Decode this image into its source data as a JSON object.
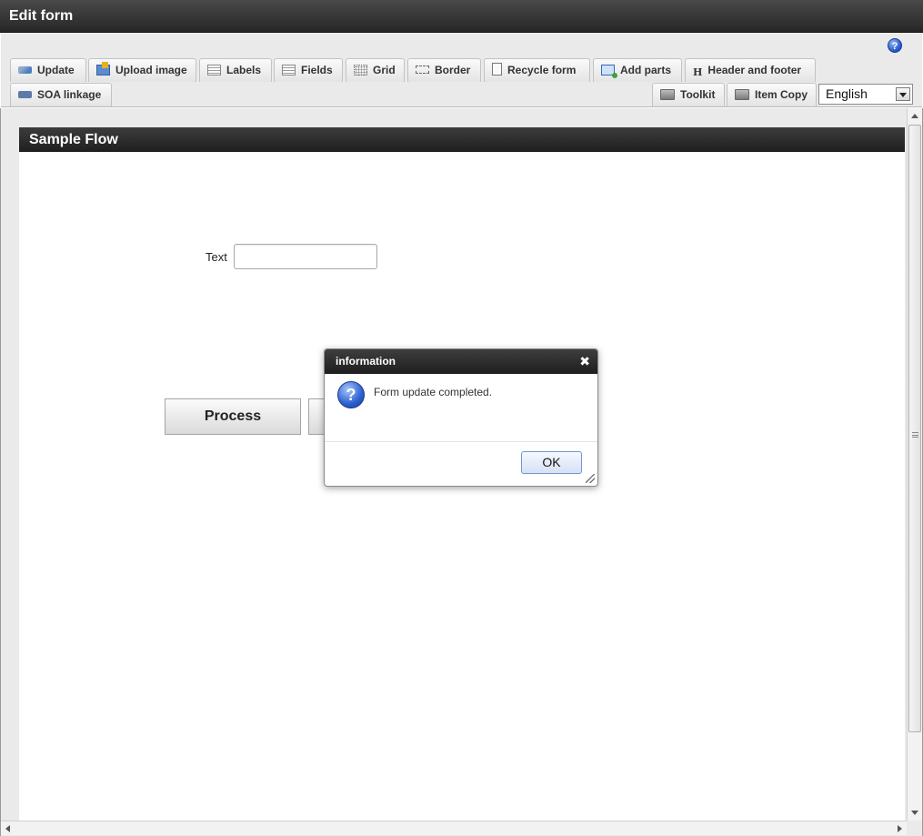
{
  "window": {
    "title": "Edit form"
  },
  "toolbar": {
    "update": "Update",
    "upload_image": "Upload image",
    "labels": "Labels",
    "fields": "Fields",
    "grid": "Grid",
    "border": "Border",
    "recycle_form": "Recycle form",
    "add_parts": "Add parts",
    "header_footer": "Header and footer",
    "header_footer_glyph": "H",
    "soa_linkage": "SOA linkage",
    "toolkit": "Toolkit",
    "item_copy": "Item Copy",
    "language": "English"
  },
  "form": {
    "title": "Sample Flow",
    "text_label": "Text",
    "text_value": "",
    "process_button": "Process",
    "second_button": ""
  },
  "dialog": {
    "title": "information",
    "close": "✖",
    "icon_glyph": "?",
    "message": "Form update completed.",
    "ok": "OK"
  },
  "help": {
    "glyph": "?"
  },
  "icons": {
    "help": "help-icon",
    "update": "update-icon",
    "upload_image": "image-icon",
    "labels": "labels-icon",
    "fields": "fields-icon",
    "grid": "grid-icon",
    "border": "border-icon",
    "recycle": "page-icon",
    "add_parts": "add-parts-icon",
    "header_footer": "header-footer-icon",
    "soa": "share-icon",
    "toolkit": "toolbox-icon",
    "item_copy": "toolbox-icon",
    "dialog": "question-icon"
  },
  "colors": {
    "header_bg": "#2b2b2b",
    "toolbar_bg": "#eaeaea",
    "accent": "#2b5fd0"
  }
}
